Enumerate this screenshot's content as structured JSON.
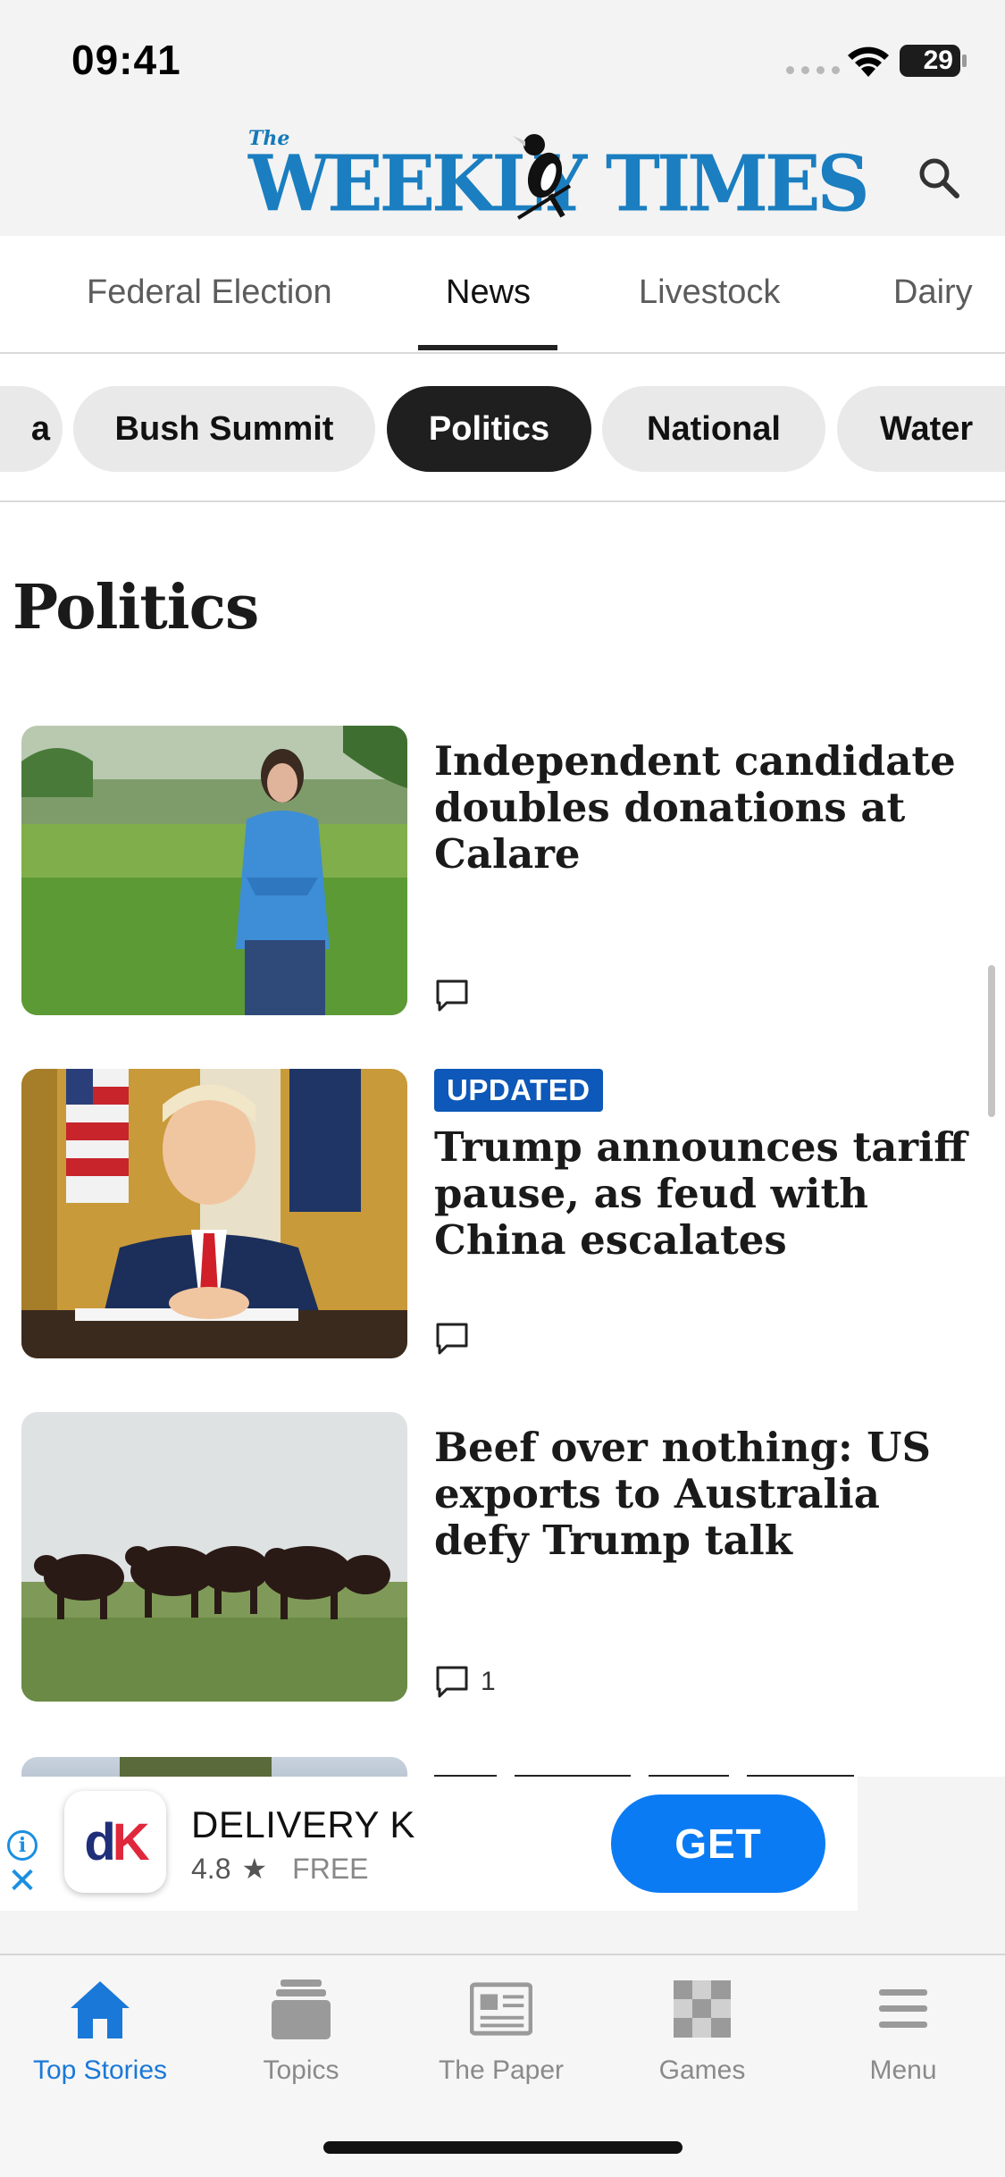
{
  "status_bar": {
    "time": "09:41",
    "battery": "29"
  },
  "header": {
    "logo_prefix": "The",
    "logo_text": "WEEKLY TIMES"
  },
  "tabs": [
    {
      "label": "Federal Election"
    },
    {
      "label": "News"
    },
    {
      "label": "Livestock"
    },
    {
      "label": "Dairy"
    }
  ],
  "pills": [
    {
      "label": "a"
    },
    {
      "label": "Bush Summit"
    },
    {
      "label": "Politics"
    },
    {
      "label": "National"
    },
    {
      "label": "Water"
    }
  ],
  "page_title": "Politics",
  "articles": [
    {
      "headline": "Independent candidate doubles donations at Calare",
      "comments": ""
    },
    {
      "badge": "UPDATED",
      "headline": "Trump announces tariff pause, as feud with China escalates",
      "comments": ""
    },
    {
      "headline": "Beef over nothing: US exports to Australia defy Trump talk",
      "comments": "1"
    }
  ],
  "ad": {
    "app_name": "DELIVERY K",
    "rating": "4.8",
    "price": "FREE",
    "cta": "GET",
    "icon_text": "dK"
  },
  "bottom_nav": [
    {
      "label": "Top Stories",
      "icon": "home-icon",
      "active": true
    },
    {
      "label": "Topics",
      "icon": "stack-icon"
    },
    {
      "label": "The Paper",
      "icon": "newspaper-icon"
    },
    {
      "label": "Games",
      "icon": "checkerboard-icon"
    },
    {
      "label": "Menu",
      "icon": "menu-icon"
    }
  ],
  "colors": {
    "brand": "#1a7ec0",
    "accent": "#1a78d8",
    "badge": "#0d58b8",
    "cta": "#0b7bf4"
  }
}
